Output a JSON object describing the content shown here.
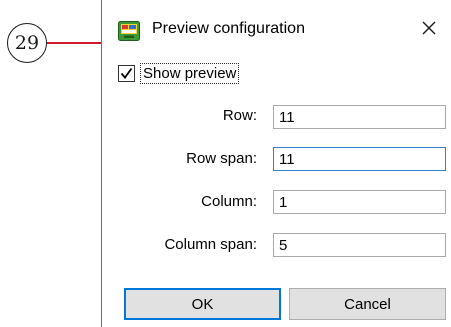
{
  "callout": {
    "number": "29",
    "line_color": "#d11a2a"
  },
  "dialog": {
    "title": "Preview configuration",
    "app_icon": "preview-app-icon",
    "close_icon": "close-icon",
    "close_glyph": "✕"
  },
  "show_preview": {
    "label": "Show preview",
    "checked": true
  },
  "fields": {
    "row": {
      "label": "Row:",
      "value": "11"
    },
    "row_span": {
      "label": "Row span:",
      "value": "11"
    },
    "column": {
      "label": "Column:",
      "value": "1"
    },
    "column_span": {
      "label": "Column span:",
      "value": "5"
    }
  },
  "buttons": {
    "ok_label": "OK",
    "cancel_label": "Cancel"
  },
  "colors": {
    "accent": "#0078d7",
    "focus_border": "#2f7fd4",
    "button_bg": "#e1e1e1"
  }
}
